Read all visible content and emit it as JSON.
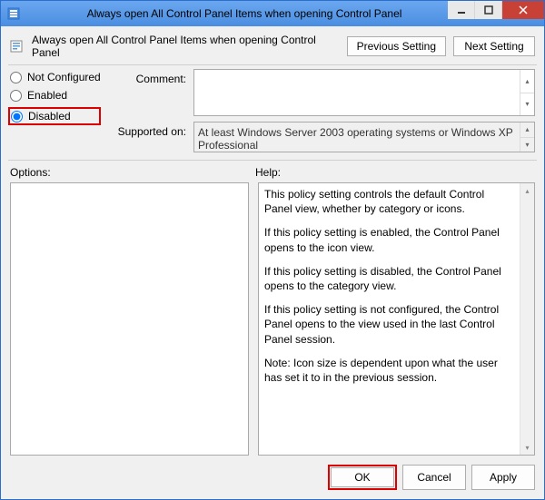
{
  "titlebar": {
    "title": "Always open All Control Panel Items when opening Control Panel"
  },
  "header": {
    "label": "Always open All Control Panel Items when opening Control Panel",
    "prev_button": "Previous Setting",
    "next_button": "Next Setting"
  },
  "radios": {
    "not_configured": "Not Configured",
    "enabled": "Enabled",
    "disabled": "Disabled",
    "selected": "disabled"
  },
  "fields": {
    "comment_label": "Comment:",
    "comment_value": "",
    "supported_label": "Supported on:",
    "supported_value": "At least Windows Server 2003 operating systems or Windows XP Professional"
  },
  "sections": {
    "options_label": "Options:",
    "help_label": "Help:"
  },
  "help": {
    "p1": "This policy setting controls the default Control Panel view, whether by category or icons.",
    "p2": "If this policy setting is enabled, the Control Panel opens to the icon view.",
    "p3": "If this policy setting is disabled, the Control Panel opens to the category view.",
    "p4": "If this policy setting is not configured, the Control Panel opens to the view used in the last Control Panel session.",
    "p5": "Note: Icon size is dependent upon what the user has set it to in the previous session."
  },
  "footer": {
    "ok": "OK",
    "cancel": "Cancel",
    "apply": "Apply"
  }
}
